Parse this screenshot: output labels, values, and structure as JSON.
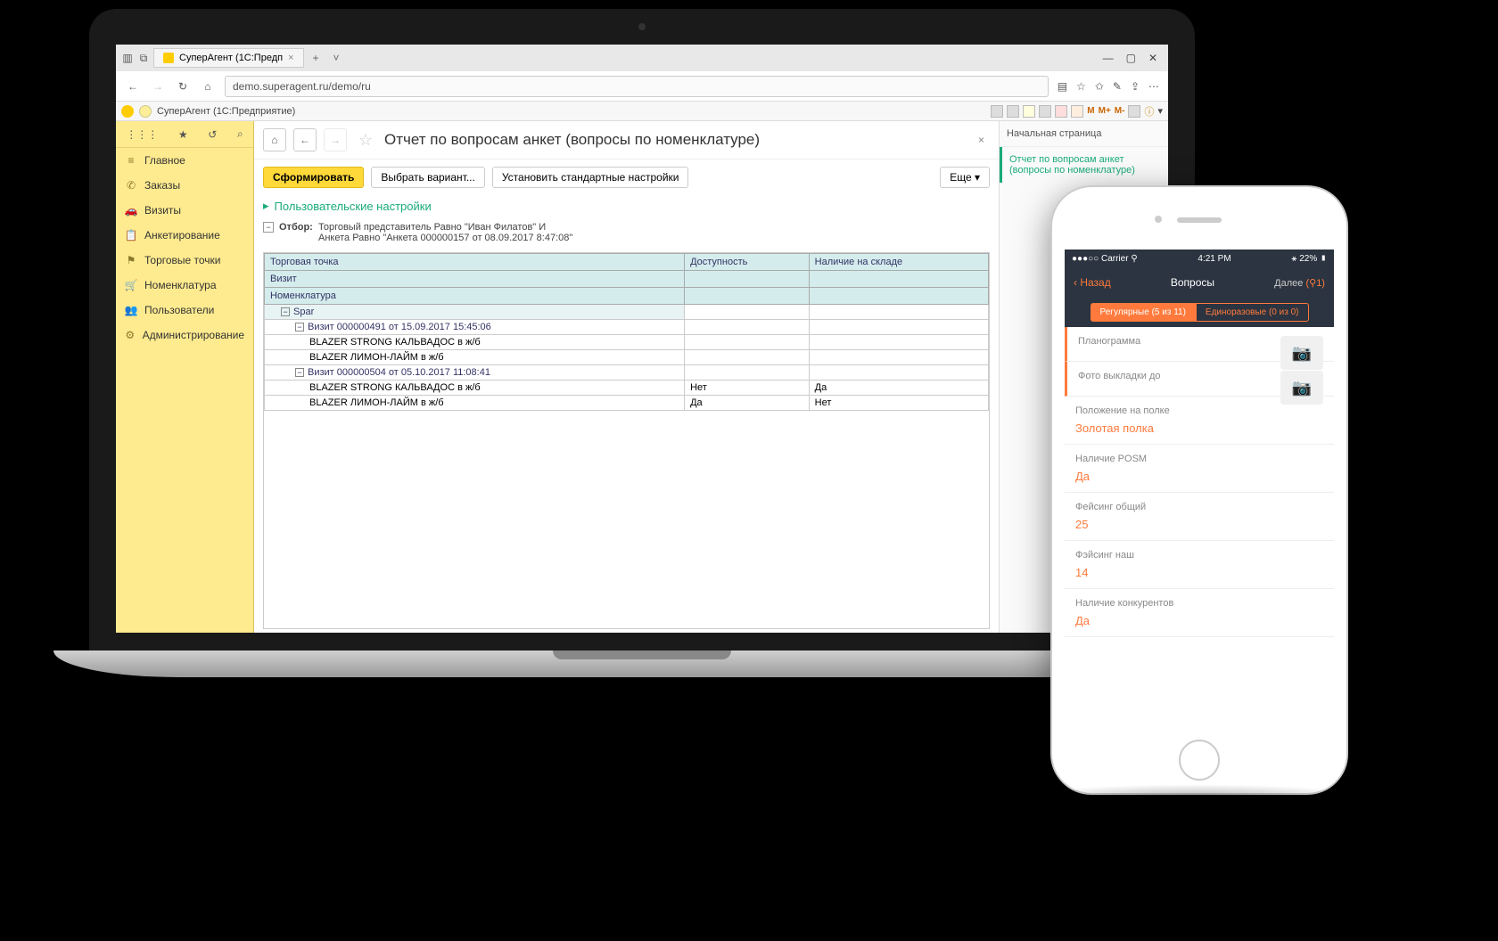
{
  "browser": {
    "tab_title": "СуперАгент (1С:Предп",
    "url": "demo.superagent.ru/demo/ru"
  },
  "onec": {
    "app_title": "СуперАгент  (1С:Предприятие)",
    "m": "M",
    "mplus": "M+",
    "mminus": "M-"
  },
  "sidebar": {
    "items": [
      {
        "icon": "≡",
        "label": "Главное"
      },
      {
        "icon": "✆",
        "label": "Заказы"
      },
      {
        "icon": "🚗",
        "label": "Визиты"
      },
      {
        "icon": "📋",
        "label": "Анкетирование"
      },
      {
        "icon": "⚑",
        "label": "Торговые точки"
      },
      {
        "icon": "🛒",
        "label": "Номенклатура"
      },
      {
        "icon": "👥",
        "label": "Пользователи"
      },
      {
        "icon": "⚙",
        "label": "Администрирование"
      }
    ]
  },
  "page": {
    "title": "Отчет по вопросам анкет (вопросы по номенклатуре)",
    "btn_form": "Сформировать",
    "btn_variant": "Выбрать вариант...",
    "btn_defaults": "Установить стандартные настройки",
    "btn_more": "Еще",
    "user_settings": "Пользовательские настройки",
    "filter_label": "Отбор:",
    "filter_line1": "Торговый представитель Равно \"Иван Филатов\" И",
    "filter_line2": "Анкета Равно \"Анкета 000000157 от 08.09.2017 8:47:08\""
  },
  "report": {
    "cols": [
      "Торговая точка",
      "Доступность",
      "Наличие на складе"
    ],
    "col_visit": "Визит",
    "col_nom": "Номенклатура",
    "group": "Spar",
    "rows": [
      {
        "lvl": 1,
        "c0": "Визит 000000491 от 15.09.2017 15:45:06",
        "c1": "",
        "c2": ""
      },
      {
        "lvl": 2,
        "c0": "BLAZER STRONG КАЛЬВАДОС в ж/б",
        "c1": "",
        "c2": ""
      },
      {
        "lvl": 2,
        "c0": "BLAZER ЛИМОН-ЛАЙМ в ж/б",
        "c1": "",
        "c2": ""
      },
      {
        "lvl": 1,
        "c0": "Визит 000000504 от 05.10.2017 11:08:41",
        "c1": "",
        "c2": ""
      },
      {
        "lvl": 2,
        "c0": "BLAZER STRONG КАЛЬВАДОС в ж/б",
        "c1": "Нет",
        "c2": "Да"
      },
      {
        "lvl": 2,
        "c0": "BLAZER ЛИМОН-ЛАЙМ в ж/б",
        "c1": "Да",
        "c2": "Нет"
      }
    ]
  },
  "rightpanel": {
    "head": "Начальная страница",
    "item": "Отчет по вопросам анкет (вопросы по номенклатуре)"
  },
  "phone": {
    "carrier": "●●●○○ Carrier ⚲",
    "time": "4:21 PM",
    "batt": "⚹ 22% ▮",
    "back": "Назад",
    "title": "Вопросы",
    "next": "Далее",
    "next_count": "(⚲1)",
    "seg_active": "Регулярные (5 из 11)",
    "seg_inactive": "Единоразовые (0 из 0)",
    "questions": [
      {
        "label": "Планограмма",
        "val": "",
        "cam": true,
        "marked": true
      },
      {
        "label": "Фото выкладки до",
        "val": "",
        "cam": true,
        "marked": true
      },
      {
        "label": "Положение на полке",
        "val": "Золотая полка"
      },
      {
        "label": "Наличие POSM",
        "val": "Да"
      },
      {
        "label": "Фейсинг общий",
        "val": "25"
      },
      {
        "label": "Фэйсинг наш",
        "val": "14"
      },
      {
        "label": "Наличие конкурентов",
        "val": "Да"
      }
    ]
  }
}
